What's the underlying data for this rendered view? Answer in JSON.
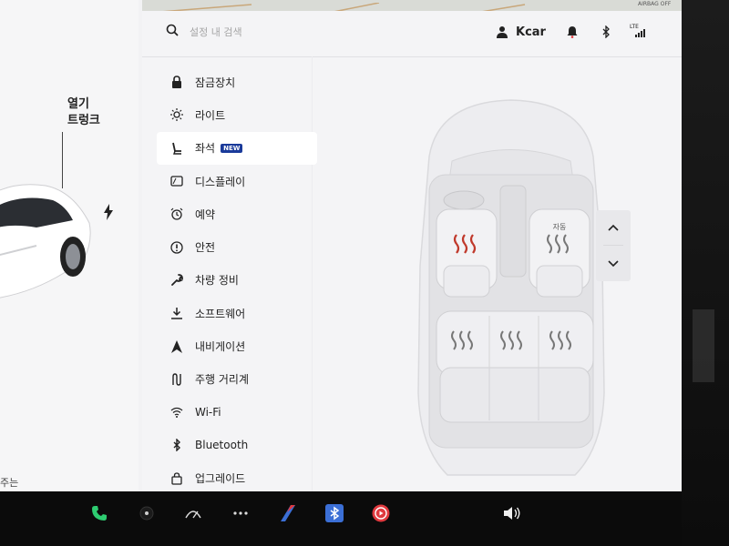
{
  "left": {
    "trunk_line1": "열기",
    "trunk_line2": "트렁크",
    "bottom_hint": "주는"
  },
  "map": {
    "airbag_label": "AIRBAG OFF"
  },
  "header": {
    "search_placeholder": "설정 내 검색",
    "username": "Kcar",
    "network": "LTE"
  },
  "menu": {
    "items": [
      {
        "label": "잠금장치",
        "icon": "lock-icon"
      },
      {
        "label": "라이트",
        "icon": "sun-icon"
      },
      {
        "label": "좌석",
        "icon": "seat-icon",
        "active": true,
        "badge": "NEW"
      },
      {
        "label": "디스플레이",
        "icon": "display-icon"
      },
      {
        "label": "예약",
        "icon": "alarm-icon"
      },
      {
        "label": "안전",
        "icon": "alert-icon"
      },
      {
        "label": "차량 정비",
        "icon": "wrench-icon"
      },
      {
        "label": "소프트웨어",
        "icon": "download-icon"
      },
      {
        "label": "내비게이션",
        "icon": "navigation-icon"
      },
      {
        "label": "주행 거리계",
        "icon": "trip-icon"
      },
      {
        "label": "Wi-Fi",
        "icon": "wifi-icon"
      },
      {
        "label": "Bluetooth",
        "icon": "bluetooth-icon"
      },
      {
        "label": "업그레이드",
        "icon": "bag-icon"
      }
    ]
  },
  "seats": {
    "passenger_label": "자동",
    "heat_color_active": "#c0392b",
    "heat_color_idle": "#777777"
  },
  "colors": {
    "accent_badge": "#1a3a9a",
    "phone_green": "#2ecc71",
    "media_red": "#e0393e",
    "bt_blue": "#3b6fd6"
  }
}
